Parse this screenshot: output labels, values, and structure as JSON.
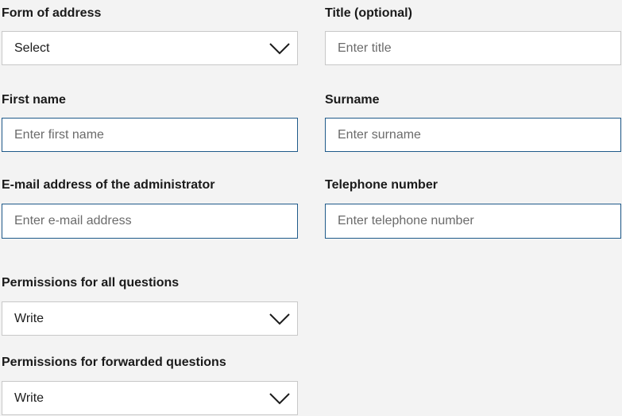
{
  "form": {
    "form_of_address": {
      "label": "Form of address",
      "value": "Select",
      "icon": "chevron-down-icon"
    },
    "title": {
      "label": "Title (optional)",
      "placeholder": "Enter title"
    },
    "first_name": {
      "label": "First name",
      "placeholder": "Enter first name"
    },
    "surname": {
      "label": "Surname",
      "placeholder": "Enter surname"
    },
    "email": {
      "label": "E-mail address of the administrator",
      "placeholder": "Enter e-mail address"
    },
    "telephone": {
      "label": "Telephone number",
      "placeholder": "Enter telephone number"
    },
    "permissions_all": {
      "label": "Permissions for all questions",
      "value": "Write",
      "icon": "chevron-down-icon"
    },
    "permissions_forwarded": {
      "label": "Permissions for forwarded questions",
      "value": "Write",
      "icon": "chevron-down-icon"
    }
  },
  "colors": {
    "background": "#f3f3f3",
    "active_border": "#1f5a8a",
    "inactive_border": "#c8c8c8",
    "placeholder_text": "#6b6b6b"
  }
}
